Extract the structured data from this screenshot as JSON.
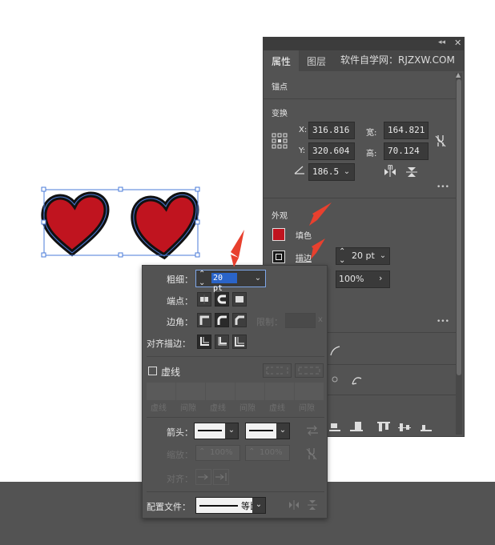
{
  "panel": {
    "tabs": [
      "属性",
      "图层",
      "软件自学网：RJZXW.COM"
    ],
    "section_anchor": "锚点",
    "section_transform": "变换",
    "x_label": "X:",
    "x_value": "316.816",
    "y_label": "Y:",
    "y_value": "320.604",
    "w_label": "宽:",
    "w_value": "164.821",
    "h_label": "高:",
    "h_value": "70.124 m",
    "angle_value": "186.5",
    "section_appearance": "外观",
    "fill_label": "填色",
    "stroke_label": "描边",
    "stroke_weight": "20 pt",
    "opacity_value": "100%",
    "more": "•••"
  },
  "stroke_popup": {
    "weight_label": "粗细：",
    "weight_value": "20 pt",
    "cap_label": "端点：",
    "corner_label": "边角：",
    "limit_label": "限制：",
    "limit_unit": "x",
    "align_label": "对齐描边：",
    "dashed_label": "虚线",
    "dash_cols": [
      "虚线",
      "间隙",
      "虚线",
      "间隙",
      "虚线",
      "间隙"
    ],
    "arrow_label": "箭头：",
    "scale_label": "缩放：",
    "scale_start": "100%",
    "scale_end": "100%",
    "align_arrow_label": "对齐：",
    "profile_label": "配置文件：",
    "profile_value": "等比"
  },
  "colors": {
    "fill": "#c0141f",
    "accent_arrow": "#e8402e",
    "selection": "#4a7bd8"
  }
}
